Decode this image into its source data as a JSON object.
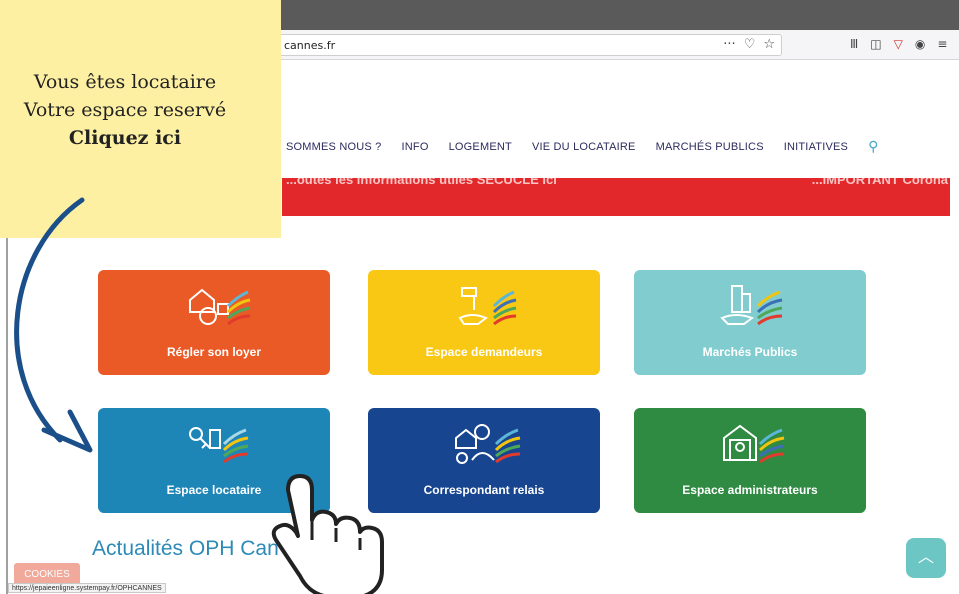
{
  "browser": {
    "url": "cannes.fr",
    "url_actions": [
      "···",
      "♡",
      "☆"
    ],
    "toolbar_icons": [
      "library-icon",
      "sidebar-icon",
      "vivaldi-icon",
      "account-icon",
      "menu-icon"
    ]
  },
  "nav": {
    "items": [
      "SOMMES NOUS ?",
      "INFO",
      "LOGEMENT",
      "VIE DU LOCATAIRE",
      "MARCHÉS PUBLICS",
      "INITIATIVES"
    ]
  },
  "banner": {
    "text_left": "...outes les informations utiles SECUCLE ici",
    "text_right": "...IMPORTANT Corona"
  },
  "tiles": [
    {
      "label": "Régler son loyer",
      "color": "#ea5a26",
      "icon": "house-money-icon"
    },
    {
      "label": "Espace demandeurs",
      "color": "#f9c814",
      "icon": "key-hand-icon"
    },
    {
      "label": "Marchés Publics",
      "color": "#80cccf",
      "icon": "buildings-hand-icon"
    },
    {
      "label": "Espace locataire",
      "color": "#1e86b7",
      "icon": "keys-icon"
    },
    {
      "label": "Correspondant relais",
      "color": "#18458f",
      "icon": "person-house-icon"
    },
    {
      "label": "Espace administrateurs",
      "color": "#2f8a42",
      "icon": "admin-house-icon"
    }
  ],
  "news": {
    "title": "Actualités OPH Can"
  },
  "cookies": {
    "label": "COOKIES"
  },
  "status_bar": {
    "url": "https://jepaieenligne.systempay.fr/OPHCANNES"
  },
  "callout": {
    "line1": "Vous êtes locataire",
    "line2": "Votre espace reservé",
    "line3": "Cliquez ici"
  },
  "colors": {
    "callout_bg": "#fdf0a2",
    "arrow": "#1b4f8a",
    "banner": "#e3282b",
    "nav_text": "#2b2b5e"
  }
}
